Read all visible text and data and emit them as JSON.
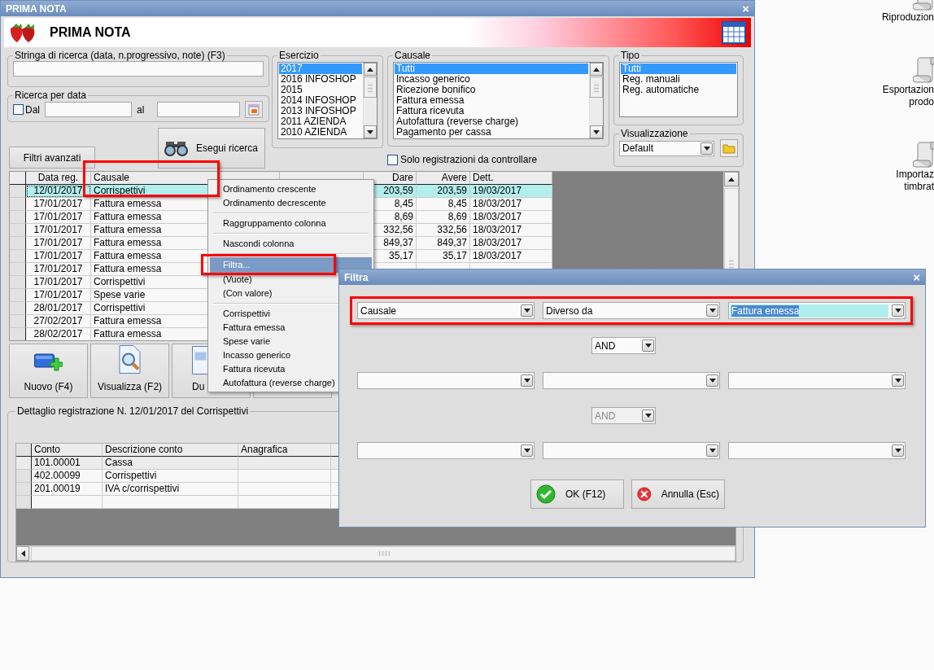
{
  "window": {
    "title": "PRIMA NOTA",
    "close": "×"
  },
  "header": {
    "title": "PRIMA NOTA"
  },
  "search": {
    "label": "Stringa di ricerca (data, n.progressivo, note) (F3)"
  },
  "date_search": {
    "label": "Ricerca per data",
    "from_label": "Dal",
    "from_checked": false,
    "to_label": "al"
  },
  "advanced_filters_button": "Filtri avanzati",
  "search_button": "Esegui ricerca",
  "esercizio": {
    "label": "Esercizio",
    "items": [
      {
        "label": "2017",
        "selected": true
      },
      {
        "label": "2016 INFOSHOP",
        "selected": false
      },
      {
        "label": "2015",
        "selected": false
      },
      {
        "label": "2014 INFOSHOP",
        "selected": false
      },
      {
        "label": "2013 INFOSHOP",
        "selected": false
      },
      {
        "label": "2011 AZIENDA",
        "selected": false
      },
      {
        "label": "2010 AZIENDA",
        "selected": false
      }
    ]
  },
  "causale": {
    "label": "Causale",
    "items": [
      {
        "label": "Tutti",
        "selected": true
      },
      {
        "label": "Incasso generico",
        "selected": false
      },
      {
        "label": "Ricezione bonifico",
        "selected": false
      },
      {
        "label": "Fattura emessa",
        "selected": false
      },
      {
        "label": "Fattura ricevuta",
        "selected": false
      },
      {
        "label": "Autofattura (reverse charge)",
        "selected": false
      },
      {
        "label": "Pagamento per cassa",
        "selected": false
      }
    ]
  },
  "only_to_check": {
    "label": "Solo registrazioni da controllare",
    "checked": false
  },
  "tipo": {
    "label": "Tipo",
    "items": [
      {
        "label": "Tutti",
        "selected": true
      },
      {
        "label": "Reg. manuali",
        "selected": false
      },
      {
        "label": "Reg. automatiche",
        "selected": false
      }
    ]
  },
  "visualizzazione": {
    "label": "Visualizzazione",
    "value": "Default"
  },
  "grid": {
    "columns": [
      {
        "label": "Data reg.",
        "annotated": false
      },
      {
        "label": "Causale",
        "annotated": true
      },
      {
        "label": "Dare",
        "annotated": false
      },
      {
        "label": "Avere",
        "annotated": false
      },
      {
        "label": "Dett.",
        "annotated": false
      }
    ],
    "rows": [
      {
        "date": "12/01/2017",
        "causale": "Corrispettivi",
        "dare": "203,59",
        "avere": "203,59",
        "dett": "19/03/2017",
        "selected": true
      },
      {
        "date": "17/01/2017",
        "causale": "Fattura emessa",
        "dare": "8,45",
        "avere": "8,45",
        "dett": "18/03/2017",
        "selected": false
      },
      {
        "date": "17/01/2017",
        "causale": "Fattura emessa",
        "dare": "8,69",
        "avere": "8,69",
        "dett": "18/03/2017",
        "selected": false
      },
      {
        "date": "17/01/2017",
        "causale": "Fattura emessa",
        "dare": "332,56",
        "avere": "332,56",
        "dett": "18/03/2017",
        "selected": false
      },
      {
        "date": "17/01/2017",
        "causale": "Fattura emessa",
        "dare": "849,37",
        "avere": "849,37",
        "dett": "18/03/2017",
        "selected": false
      },
      {
        "date": "17/01/2017",
        "causale": "Fattura emessa",
        "dare": "35,17",
        "avere": "35,17",
        "dett": "18/03/2017",
        "selected": false
      },
      {
        "date": "17/01/2017",
        "causale": "Fattura emessa",
        "selected": false
      },
      {
        "date": "17/01/2017",
        "causale": "Corrispettivi",
        "selected": false
      },
      {
        "date": "17/01/2017",
        "causale": "Spese varie",
        "selected": false
      },
      {
        "date": "28/01/2017",
        "causale": "Corrispettivi",
        "selected": false
      },
      {
        "date": "27/02/2017",
        "causale": "Fattura emessa",
        "selected": false
      },
      {
        "date": "28/02/2017",
        "causale": "Fattura emessa",
        "selected": false
      }
    ]
  },
  "actions": [
    {
      "kind": "new",
      "label": "Nuovo (F4)"
    },
    {
      "kind": "view",
      "label": "Visualizza (F2)"
    },
    {
      "kind": "copy",
      "label": "Du"
    },
    {
      "kind": "blank"
    }
  ],
  "detail": {
    "title": "Dettaglio registrazione N. 12/01/2017 del Corrispettivi",
    "columns": [
      "Conto",
      "Descrizione conto",
      "Anagrafica"
    ],
    "rows": [
      {
        "conto": "101.00001",
        "descrizione": "Cassa"
      },
      {
        "conto": "402.00099",
        "descrizione": "Corrispettivi"
      },
      {
        "conto": "201.00019",
        "descrizione": "IVA c/corrispettivi"
      },
      {}
    ]
  },
  "desktop_icons": [
    {
      "lines": [
        "Riproduzion"
      ]
    },
    {
      "lines": [
        "Esportazion",
        "prodo"
      ]
    },
    {
      "lines": [
        "Importaz",
        "timbrat"
      ]
    }
  ],
  "context_menu": [
    {
      "kind": "item",
      "label": "Ordinamento crescente",
      "selected": false,
      "annotated": false
    },
    {
      "kind": "item",
      "label": "Ordinamento decrescente",
      "selected": false,
      "annotated": false
    },
    {
      "kind": "separator"
    },
    {
      "kind": "item",
      "label": "Raggruppamento colonna",
      "selected": false,
      "annotated": false
    },
    {
      "kind": "separator"
    },
    {
      "kind": "item",
      "label": "Nascondi colonna",
      "selected": false,
      "annotated": false
    },
    {
      "kind": "separator"
    },
    {
      "kind": "item",
      "label": "Filtra...",
      "selected": true,
      "annotated": true
    },
    {
      "kind": "item",
      "label": "(Vuote)",
      "selected": false,
      "annotated": false
    },
    {
      "kind": "item",
      "label": "(Con valore)",
      "selected": false,
      "annotated": false
    },
    {
      "kind": "separator"
    },
    {
      "kind": "item",
      "label": "Corrispettivi",
      "selected": false,
      "annotated": false
    },
    {
      "kind": "item",
      "label": "Fattura emessa",
      "selected": false,
      "annotated": false
    },
    {
      "kind": "item",
      "label": "Spese varie",
      "selected": false,
      "annotated": false
    },
    {
      "kind": "item",
      "label": "Incasso generico",
      "selected": false,
      "annotated": false
    },
    {
      "kind": "item",
      "label": "Fattura ricevuta",
      "selected": false,
      "annotated": false
    },
    {
      "kind": "item",
      "label": "Autofattura (reverse charge)",
      "selected": false,
      "annotated": false
    }
  ],
  "dialog": {
    "title": "Filtra",
    "close": "×",
    "conditions": [
      {
        "field": "Causale",
        "operator": "Diverso da",
        "value": "Fattura emessa",
        "value_selected": true,
        "annotated": true
      },
      {
        "annotated": false
      },
      {
        "annotated": false
      }
    ],
    "connectors": [
      {
        "value": "AND",
        "disabled": false
      },
      {
        "value": "AND",
        "disabled": true
      }
    ],
    "buttons": [
      {
        "kind": "ok",
        "label": "OK (F12)"
      },
      {
        "kind": "cancel",
        "label": "Annulla (Esc)"
      }
    ]
  }
}
